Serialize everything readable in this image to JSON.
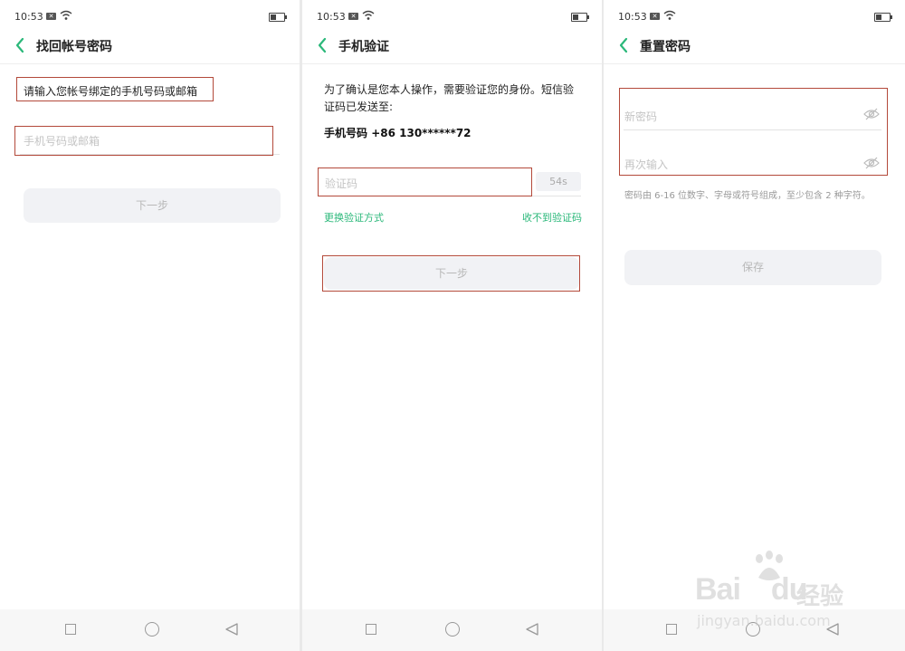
{
  "status_bar": {
    "time": "10:53"
  },
  "screen1": {
    "title": "找回帐号密码",
    "prompt": "请输入您帐号绑定的手机号码或邮箱",
    "input_placeholder": "手机号码或邮箱",
    "next_label": "下一步"
  },
  "screen2": {
    "title": "手机验证",
    "message": "为了确认是您本人操作，需要验证您的身份。短信验证码已发送至:",
    "phone_label": "手机号码",
    "phone_value": "+86 130******72",
    "code_placeholder": "验证码",
    "countdown": "54s",
    "switch_method": "更换验证方式",
    "no_code": "收不到验证码",
    "next_label": "下一步"
  },
  "screen3": {
    "title": "重置密码",
    "new_password_placeholder": "新密码",
    "confirm_placeholder": "再次输入",
    "hint": "密码由 6-16 位数字、字母或符号组成，至少包含 2 种字符。",
    "save_label": "保存"
  },
  "watermark": {
    "logo": "Bai",
    "logo2": "du",
    "cn": "经验",
    "url": "jingyan.baidu.com"
  },
  "colors": {
    "accent": "#2bb87a",
    "highlight": "#b3493a",
    "disabled_bg": "#f1f2f5"
  },
  "icons": [
    "back-chevron-icon",
    "wifi-icon",
    "battery-icon",
    "eye-off-icon",
    "square-icon",
    "circle-icon",
    "triangle-back-icon"
  ]
}
